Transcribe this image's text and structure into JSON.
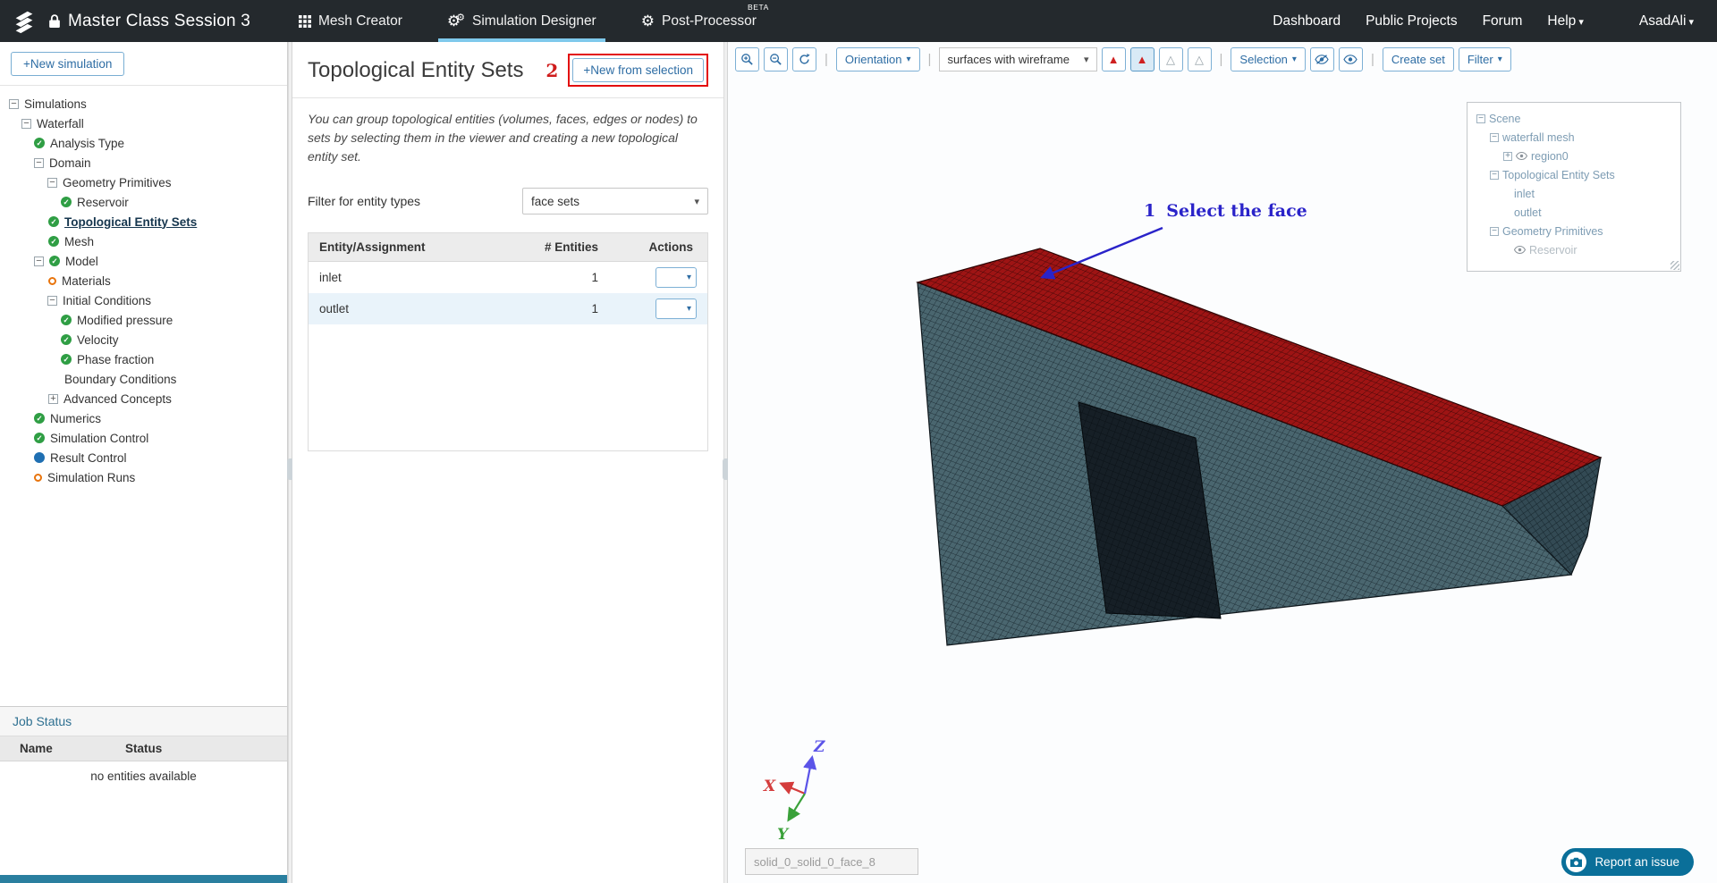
{
  "colors": {
    "navbar_bg": "#24292d",
    "accent_blue": "#2e6da4",
    "active_tab_underline": "#7fc9ec",
    "annotation_red": "#cf1b1b",
    "annotation_blue": "#2a23c9",
    "selected_face_red": "#9e1414",
    "mesh_surface_teal": "#4a666f",
    "mesh_shadow_dark": "#161f26",
    "job_status_teal": "#2e7091",
    "report_button_teal": "#0a6f99",
    "row_alt_blue": "#e9f3fa"
  },
  "icons": {
    "navbar": [
      "simscale-logo-icon",
      "lock-icon",
      "grid-icon",
      "gears-icon",
      "gear-icon",
      "caret-down-icon"
    ],
    "sidebar_tree": [
      "collapse-icon",
      "expand-icon",
      "check-icon",
      "incomplete-icon",
      "result-icon"
    ],
    "viewer_toolbar": [
      "zoom-in-icon",
      "zoom-out-icon",
      "refresh-icon",
      "triangle-solid-icon",
      "triangle-outline-icon",
      "eye-slash-icon",
      "eye-icon",
      "caret-down-icon"
    ],
    "scene_tree": [
      "collapse-icon",
      "expand-icon",
      "eye-icon",
      "resize-grip-icon"
    ],
    "viewer_misc": [
      "axis-triad-icon",
      "camera-icon",
      "arrow-annotation-icon"
    ]
  },
  "navbar": {
    "project_title": "Master Class Session 3",
    "tabs": [
      {
        "label": "Mesh Creator",
        "icon": "grid-icon",
        "active": false
      },
      {
        "label": "Simulation Designer",
        "icon": "gears-icon",
        "active": true
      },
      {
        "label": "Post-Processor",
        "icon": "gear-icon",
        "active": false,
        "badge": "BETA"
      }
    ],
    "links": [
      "Dashboard",
      "Public Projects",
      "Forum"
    ],
    "help_label": "Help",
    "user_label": "AsadAli"
  },
  "sidebar": {
    "new_simulation_label": "+New simulation",
    "tree": [
      {
        "label": "Simulations",
        "indent": 10,
        "icon": "minus"
      },
      {
        "label": "Waterfall",
        "indent": 24,
        "icon": "minus"
      },
      {
        "label": "Analysis Type",
        "indent": 38,
        "icon": "check"
      },
      {
        "label": "Domain",
        "indent": 38,
        "icon": "minus"
      },
      {
        "label": "Geometry Primitives",
        "indent": 53,
        "icon": "minus"
      },
      {
        "label": "Reservoir",
        "indent": 68,
        "icon": "check"
      },
      {
        "label": "Topological Entity Sets",
        "indent": 54,
        "icon": "check",
        "selected": true
      },
      {
        "label": "Mesh",
        "indent": 54,
        "icon": "check"
      },
      {
        "label": "Model",
        "indent": 38,
        "icon": "minus",
        "icon2": "check"
      },
      {
        "label": "Materials",
        "indent": 54,
        "icon": "orange"
      },
      {
        "label": "Initial Conditions",
        "indent": 53,
        "icon": "minus"
      },
      {
        "label": "Modified pressure",
        "indent": 68,
        "icon": "check"
      },
      {
        "label": "Velocity",
        "indent": 68,
        "icon": "check"
      },
      {
        "label": "Phase fraction",
        "indent": 68,
        "icon": "check"
      },
      {
        "label": "Boundary Conditions",
        "indent": 54,
        "icon": "none"
      },
      {
        "label": "Advanced Concepts",
        "indent": 54,
        "icon": "plus"
      },
      {
        "label": "Numerics",
        "indent": 38,
        "icon": "check"
      },
      {
        "label": "Simulation Control",
        "indent": 38,
        "icon": "check"
      },
      {
        "label": "Result Control",
        "indent": 38,
        "icon": "blue"
      },
      {
        "label": "Simulation Runs",
        "indent": 38,
        "icon": "orange"
      }
    ],
    "job_status": {
      "title": "Job Status",
      "columns": [
        "Name",
        "Status"
      ],
      "empty_text": "no entities available"
    }
  },
  "panel": {
    "title": "Topological Entity Sets",
    "annotation_step2": "2",
    "new_from_selection_label": "+New from selection",
    "description": "You can group topological entities (volumes, faces, edges or nodes) to sets by selecting them in the viewer and creating a new topological entity set.",
    "filter_label": "Filter for entity types",
    "filter_value": "face sets",
    "table": {
      "columns": [
        "Entity/Assignment",
        "# Entities",
        "Actions"
      ],
      "rows": [
        {
          "name": "inlet",
          "entities": "1"
        },
        {
          "name": "outlet",
          "entities": "1"
        }
      ]
    }
  },
  "viewer": {
    "toolbar": {
      "orientation_label": "Orientation",
      "render_mode_value": "surfaces with wireframe",
      "selection_label": "Selection",
      "create_set_label": "Create set",
      "filter_label": "Filter"
    },
    "annotation": {
      "number": "1",
      "text": "Select the face"
    },
    "scene_tree": [
      {
        "label": "Scene",
        "indent": 0,
        "icon": "minus"
      },
      {
        "label": "waterfall mesh",
        "indent": 1,
        "icon": "minus"
      },
      {
        "label": "region0",
        "indent": 2,
        "icon": "plus",
        "eye": true
      },
      {
        "label": "Topological Entity Sets",
        "indent": 1,
        "icon": "minus"
      },
      {
        "label": "inlet",
        "indent": 2,
        "icon": "none"
      },
      {
        "label": "outlet",
        "indent": 2,
        "icon": "none"
      },
      {
        "label": "Geometry Primitives",
        "indent": 1,
        "icon": "minus"
      },
      {
        "label": "Reservoir",
        "indent": 2,
        "icon": "none",
        "eye": true,
        "grayed": true
      }
    ],
    "axis_labels": {
      "x": "X",
      "y": "Y",
      "z": "Z"
    },
    "tooltip": "solid_0_solid_0_face_8",
    "report_issue_label": "Report an issue"
  }
}
